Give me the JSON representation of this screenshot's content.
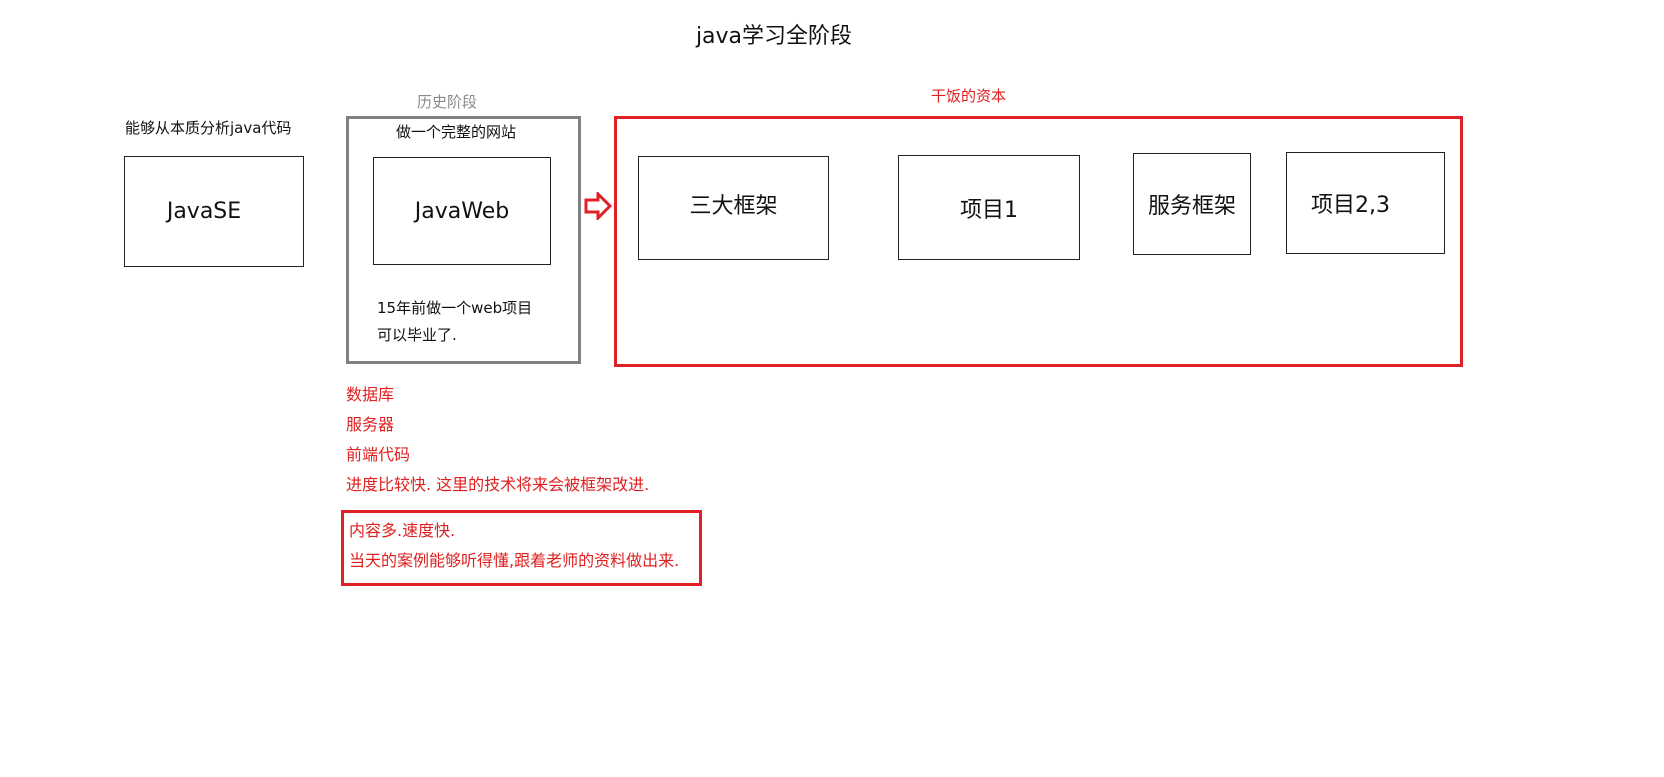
{
  "title": "java学习全阶段",
  "javase": {
    "caption": "能够从本质分析java代码",
    "label": "JavaSE"
  },
  "history": {
    "caption": "历史阶段",
    "header": "做一个完整的网站",
    "inner_label": "JavaWeb",
    "note_line1": "15年前做一个web项目",
    "note_line2": "可以毕业了."
  },
  "capital": {
    "caption": "干饭的资本",
    "items": [
      "三大框架",
      "项目1",
      "服务框架",
      "项目2,3"
    ]
  },
  "notes": {
    "lines": [
      "数据库",
      "服务器",
      "前端代码",
      "进度比较快. 这里的技术将来会被框架改进."
    ]
  },
  "tip": {
    "lines": [
      "内容多.速度快.",
      "当天的案例能够听得懂,跟着老师的资料做出来."
    ]
  },
  "colors": {
    "red": "#e02025",
    "gray": "#7f7f7f",
    "text": "#111111"
  }
}
